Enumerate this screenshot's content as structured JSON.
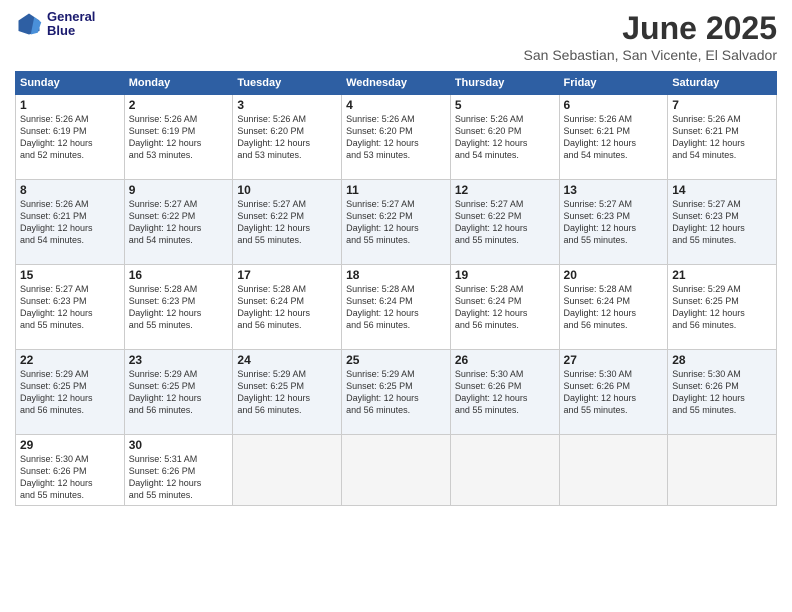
{
  "header": {
    "logo": {
      "line1": "General",
      "line2": "Blue"
    },
    "title": "June 2025",
    "location": "San Sebastian, San Vicente, El Salvador"
  },
  "weekdays": [
    "Sunday",
    "Monday",
    "Tuesday",
    "Wednesday",
    "Thursday",
    "Friday",
    "Saturday"
  ],
  "weeks": [
    [
      {
        "day": "1",
        "info": "Sunrise: 5:26 AM\nSunset: 6:19 PM\nDaylight: 12 hours\nand 52 minutes."
      },
      {
        "day": "2",
        "info": "Sunrise: 5:26 AM\nSunset: 6:19 PM\nDaylight: 12 hours\nand 53 minutes."
      },
      {
        "day": "3",
        "info": "Sunrise: 5:26 AM\nSunset: 6:20 PM\nDaylight: 12 hours\nand 53 minutes."
      },
      {
        "day": "4",
        "info": "Sunrise: 5:26 AM\nSunset: 6:20 PM\nDaylight: 12 hours\nand 53 minutes."
      },
      {
        "day": "5",
        "info": "Sunrise: 5:26 AM\nSunset: 6:20 PM\nDaylight: 12 hours\nand 54 minutes."
      },
      {
        "day": "6",
        "info": "Sunrise: 5:26 AM\nSunset: 6:21 PM\nDaylight: 12 hours\nand 54 minutes."
      },
      {
        "day": "7",
        "info": "Sunrise: 5:26 AM\nSunset: 6:21 PM\nDaylight: 12 hours\nand 54 minutes."
      }
    ],
    [
      {
        "day": "8",
        "info": "Sunrise: 5:26 AM\nSunset: 6:21 PM\nDaylight: 12 hours\nand 54 minutes."
      },
      {
        "day": "9",
        "info": "Sunrise: 5:27 AM\nSunset: 6:22 PM\nDaylight: 12 hours\nand 54 minutes."
      },
      {
        "day": "10",
        "info": "Sunrise: 5:27 AM\nSunset: 6:22 PM\nDaylight: 12 hours\nand 55 minutes."
      },
      {
        "day": "11",
        "info": "Sunrise: 5:27 AM\nSunset: 6:22 PM\nDaylight: 12 hours\nand 55 minutes."
      },
      {
        "day": "12",
        "info": "Sunrise: 5:27 AM\nSunset: 6:22 PM\nDaylight: 12 hours\nand 55 minutes."
      },
      {
        "day": "13",
        "info": "Sunrise: 5:27 AM\nSunset: 6:23 PM\nDaylight: 12 hours\nand 55 minutes."
      },
      {
        "day": "14",
        "info": "Sunrise: 5:27 AM\nSunset: 6:23 PM\nDaylight: 12 hours\nand 55 minutes."
      }
    ],
    [
      {
        "day": "15",
        "info": "Sunrise: 5:27 AM\nSunset: 6:23 PM\nDaylight: 12 hours\nand 55 minutes."
      },
      {
        "day": "16",
        "info": "Sunrise: 5:28 AM\nSunset: 6:23 PM\nDaylight: 12 hours\nand 55 minutes."
      },
      {
        "day": "17",
        "info": "Sunrise: 5:28 AM\nSunset: 6:24 PM\nDaylight: 12 hours\nand 56 minutes."
      },
      {
        "day": "18",
        "info": "Sunrise: 5:28 AM\nSunset: 6:24 PM\nDaylight: 12 hours\nand 56 minutes."
      },
      {
        "day": "19",
        "info": "Sunrise: 5:28 AM\nSunset: 6:24 PM\nDaylight: 12 hours\nand 56 minutes."
      },
      {
        "day": "20",
        "info": "Sunrise: 5:28 AM\nSunset: 6:24 PM\nDaylight: 12 hours\nand 56 minutes."
      },
      {
        "day": "21",
        "info": "Sunrise: 5:29 AM\nSunset: 6:25 PM\nDaylight: 12 hours\nand 56 minutes."
      }
    ],
    [
      {
        "day": "22",
        "info": "Sunrise: 5:29 AM\nSunset: 6:25 PM\nDaylight: 12 hours\nand 56 minutes."
      },
      {
        "day": "23",
        "info": "Sunrise: 5:29 AM\nSunset: 6:25 PM\nDaylight: 12 hours\nand 56 minutes."
      },
      {
        "day": "24",
        "info": "Sunrise: 5:29 AM\nSunset: 6:25 PM\nDaylight: 12 hours\nand 56 minutes."
      },
      {
        "day": "25",
        "info": "Sunrise: 5:29 AM\nSunset: 6:25 PM\nDaylight: 12 hours\nand 56 minutes."
      },
      {
        "day": "26",
        "info": "Sunrise: 5:30 AM\nSunset: 6:26 PM\nDaylight: 12 hours\nand 55 minutes."
      },
      {
        "day": "27",
        "info": "Sunrise: 5:30 AM\nSunset: 6:26 PM\nDaylight: 12 hours\nand 55 minutes."
      },
      {
        "day": "28",
        "info": "Sunrise: 5:30 AM\nSunset: 6:26 PM\nDaylight: 12 hours\nand 55 minutes."
      }
    ],
    [
      {
        "day": "29",
        "info": "Sunrise: 5:30 AM\nSunset: 6:26 PM\nDaylight: 12 hours\nand 55 minutes."
      },
      {
        "day": "30",
        "info": "Sunrise: 5:31 AM\nSunset: 6:26 PM\nDaylight: 12 hours\nand 55 minutes."
      },
      {
        "day": "",
        "info": ""
      },
      {
        "day": "",
        "info": ""
      },
      {
        "day": "",
        "info": ""
      },
      {
        "day": "",
        "info": ""
      },
      {
        "day": "",
        "info": ""
      }
    ]
  ]
}
